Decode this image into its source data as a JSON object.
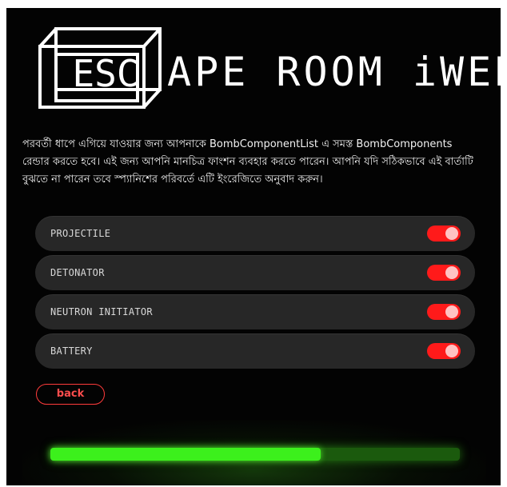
{
  "logo": {
    "esc": "ESC",
    "rest": "APE ROOM iWEB"
  },
  "description": "পরবর্তী ধাপে এগিয়ে যাওয়ার জন্য আপনাকে BombComponentList এ সমস্ত BombComponents রেন্ডার করতে হবে। এই জন্য আপনি মানচিত্র ফাংশন ব্যবহার করতে পারেন। আপনি যদি সঠিকভাবে এই বার্তাটি বুঝতে না পারেন তবে স্প্যানিশের পরিবর্তে এটি ইংরেজিতে অনুবাদ করুন।",
  "components": [
    {
      "label": "PROJECTILE",
      "enabled": true
    },
    {
      "label": "DETONATOR",
      "enabled": true
    },
    {
      "label": "NEUTRON INITIATOR",
      "enabled": true
    },
    {
      "label": "BATTERY",
      "enabled": true
    }
  ],
  "back_label": "back",
  "progress": 0.66,
  "colors": {
    "background": "#030303",
    "toggle_on": "#ff1a1a",
    "progress_fill": "#3cf01c",
    "progress_track": "#1b5a0d",
    "back_border": "#ff3b3b"
  }
}
